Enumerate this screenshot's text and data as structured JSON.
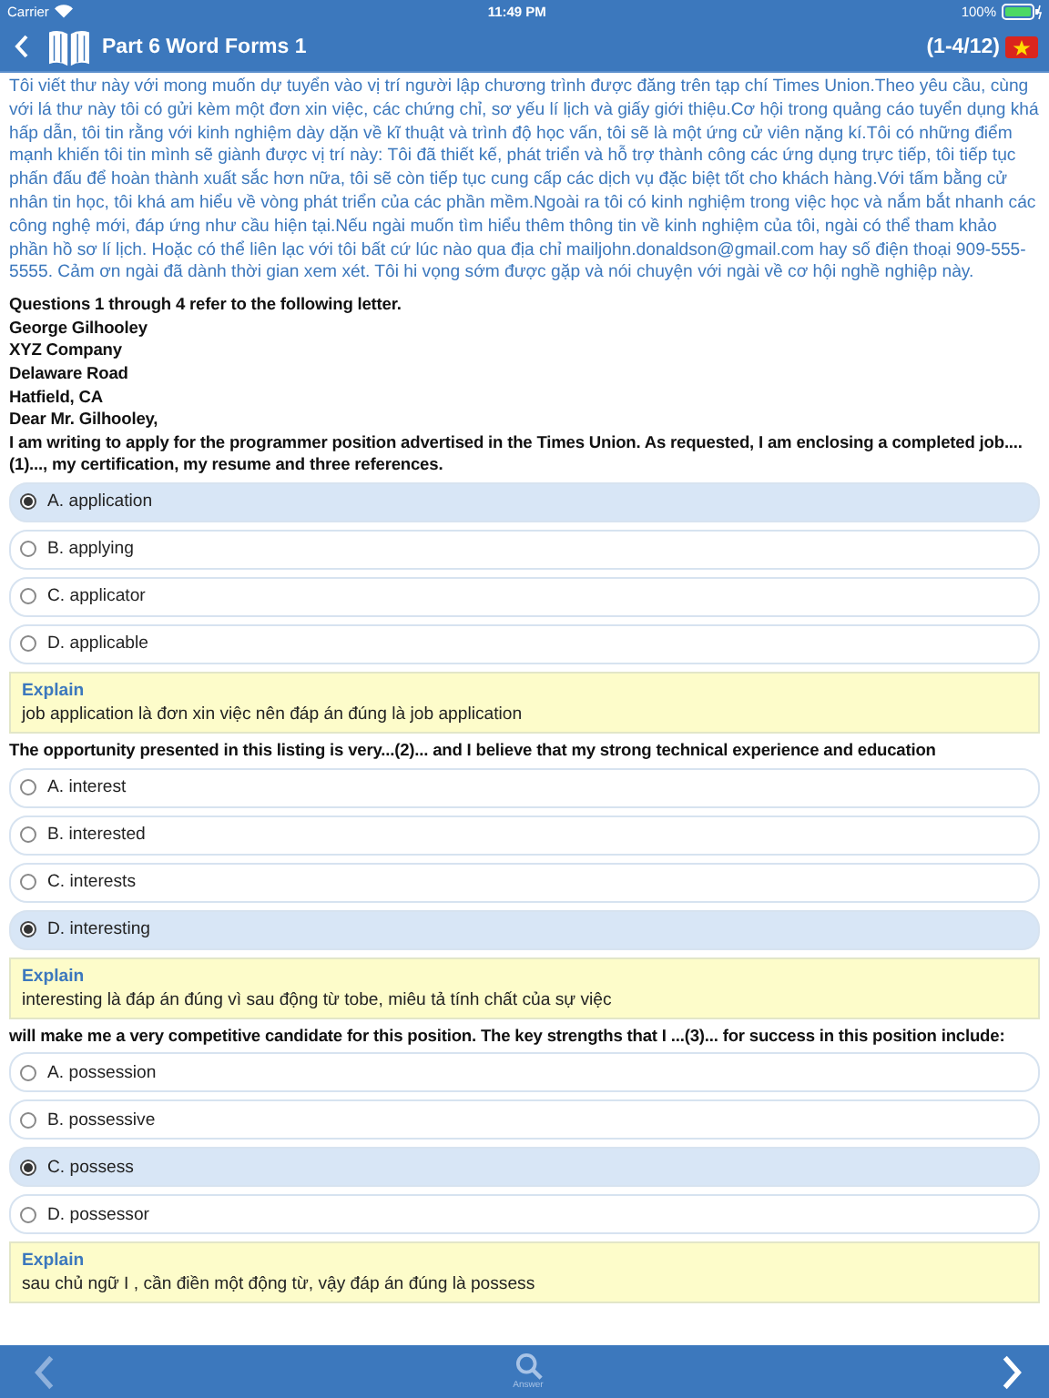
{
  "status_bar": {
    "carrier": "Carrier",
    "time": "11:49 PM",
    "battery": "100%"
  },
  "nav": {
    "title": "Part 6 Word Forms 1",
    "counter": "(1-4/12)"
  },
  "passage": "Tôi viết thư này với mong muốn dự tuyển vào vị trí người lập chương trình được đăng trên tạp chí Times Union.Theo yêu cầu, cùng với lá thư này tôi có gửi kèm một đơn xin việc, các chứng chỉ, sơ yếu lí lịch và giấy giới thiệu.Cơ hội trong quảng cáo tuyển dụng khá hấp dẫn, tôi tin rằng với kinh nghiệm dày dặn về kĩ thuật và trình độ học vấn, tôi sẽ là một ứng cử viên nặng kí.Tôi có những điểm mạnh khiến tôi tin mình sẽ giành được vị trí này: Tôi đã thiết kế, phát triển và hỗ trợ thành công các ứng dụng trực tiếp, tôi tiếp tục phấn đấu để hoàn thành xuất sắc hơn nữa, tôi sẽ còn tiếp tục cung cấp các dịch vụ đặc biệt tốt cho khách hàng.Với tấm bằng cử nhân tin học, tôi khá am hiểu về vòng phát triển của các phần mềm.Ngoài ra tôi có kinh nghiệm trong việc học và nắm bắt nhanh các công nghệ mới, đáp ứng như cầu hiện tại.Nếu ngài muốn tìm hiểu thêm thông tin về kinh nghiệm của tôi, ngài có thể tham khảo phần hồ sơ lí lịch. Hoặc có thể liên lạc với tôi bất cứ lúc nào qua địa chỉ mailjohn.donaldson@gmail.com hay số điện thoại 909-555-5555. Cảm ơn ngài đã dành thời gian xem xét. Tôi hi vọng sớm được gặp và nói chuyện với ngài về cơ hội nghề nghiệp này.",
  "intro": [
    "Questions 1 through 4 refer to the following letter.",
    "George Gilhooley",
    "XYZ Company",
    "Delaware Road",
    "Hatfield, CA",
    "Dear Mr. Gilhooley,"
  ],
  "questions": [
    {
      "prompt": "I am writing to apply for the programmer position advertised in the Times Union. As requested, I am enclosing a completed job....(1)..., my certification, my resume and three references.",
      "options": [
        {
          "text": "A. application",
          "selected": true
        },
        {
          "text": "B. applying",
          "selected": false
        },
        {
          "text": "C. applicator",
          "selected": false
        },
        {
          "text": "D. applicable",
          "selected": false
        }
      ],
      "explain": {
        "label": "Explain",
        "text": "job application là đơn xin việc nên đáp án đúng là job application"
      }
    },
    {
      "prompt": "The opportunity presented in this listing is very...(2)... and I believe that my strong technical experience and education",
      "options": [
        {
          "text": "A. interest",
          "selected": false
        },
        {
          "text": "B. interested",
          "selected": false
        },
        {
          "text": "C. interests",
          "selected": false
        },
        {
          "text": "D. interesting",
          "selected": true
        }
      ],
      "explain": {
        "label": "Explain",
        "text": "interesting là đáp án đúng vì sau động từ tobe, miêu tả tính chất của sự việc"
      }
    },
    {
      "prompt": "will make me a very competitive candidate for this position. The key strengths that I ...(3)... for success in this position include:",
      "options": [
        {
          "text": "A. possession",
          "selected": false
        },
        {
          "text": "B. possessive",
          "selected": false
        },
        {
          "text": "C. possess",
          "selected": true
        },
        {
          "text": "D. possessor",
          "selected": false
        }
      ],
      "explain": {
        "label": "Explain",
        "text": "sau chủ ngữ  I , cần điền một động từ, vậy đáp án đúng là  possess"
      }
    }
  ],
  "toolbar": {
    "answer_label": "Answer"
  }
}
